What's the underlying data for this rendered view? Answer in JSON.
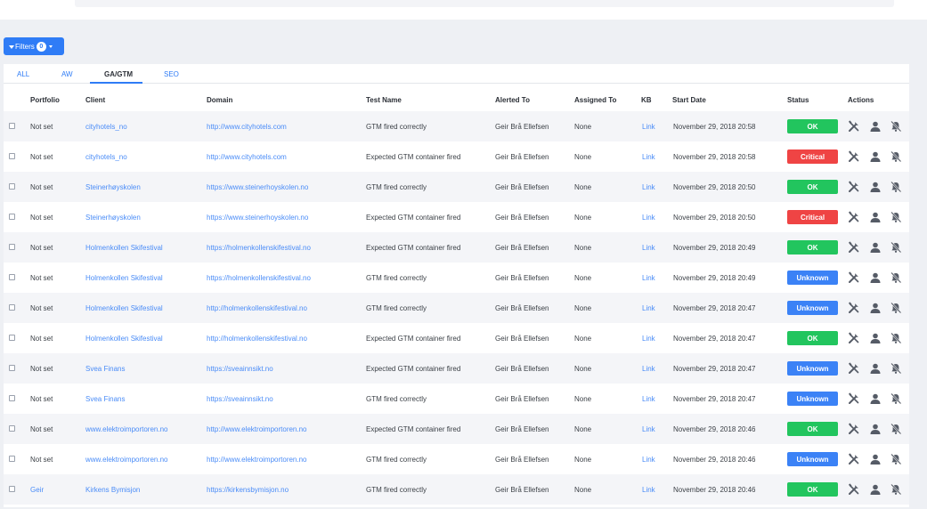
{
  "filters": {
    "label": "Filters",
    "count": "0"
  },
  "tabs": [
    "ALL",
    "AW",
    "GA/GTM",
    "SEO"
  ],
  "active_tab": "GA/GTM",
  "columns": [
    "Portfolio",
    "Client",
    "Domain",
    "Test Name",
    "Alerted To",
    "Assigned To",
    "KB",
    "Start Date",
    "Status",
    "Actions"
  ],
  "status_colors": {
    "OK": "#22c55e",
    "Critical": "#ef4444",
    "Unknown": "#3b82f6"
  },
  "icons": [
    "tools-icon",
    "user-icon",
    "bell-off-icon"
  ],
  "rows": [
    {
      "portfolio": "Not set",
      "client": "cityhotels_no",
      "domain": "http://www.cityhotels.com",
      "test": "GTM fired correctly",
      "alerted": "Geir Brå Ellefsen",
      "assigned": "None",
      "kb": "Link",
      "date": "November 29, 2018 20:58",
      "status": "OK"
    },
    {
      "portfolio": "Not set",
      "client": "cityhotels_no",
      "domain": "http://www.cityhotels.com",
      "test": "Expected GTM container fired",
      "alerted": "Geir Brå Ellefsen",
      "assigned": "None",
      "kb": "Link",
      "date": "November 29, 2018 20:58",
      "status": "Critical"
    },
    {
      "portfolio": "Not set",
      "client": "Steinerhøyskolen",
      "domain": "https://www.steinerhoyskolen.no",
      "test": "GTM fired correctly",
      "alerted": "Geir Brå Ellefsen",
      "assigned": "None",
      "kb": "Link",
      "date": "November 29, 2018 20:50",
      "status": "OK"
    },
    {
      "portfolio": "Not set",
      "client": "Steinerhøyskolen",
      "domain": "https://www.steinerhoyskolen.no",
      "test": "Expected GTM container fired",
      "alerted": "Geir Brå Ellefsen",
      "assigned": "None",
      "kb": "Link",
      "date": "November 29, 2018 20:50",
      "status": "Critical"
    },
    {
      "portfolio": "Not set",
      "client": "Holmenkollen Skifestival",
      "domain": "https://holmenkollenskifestival.no",
      "test": "Expected GTM container fired",
      "alerted": "Geir Brå Ellefsen",
      "assigned": "None",
      "kb": "Link",
      "date": "November 29, 2018 20:49",
      "status": "OK"
    },
    {
      "portfolio": "Not set",
      "client": "Holmenkollen Skifestival",
      "domain": "https://holmenkollenskifestival.no",
      "test": "GTM fired correctly",
      "alerted": "Geir Brå Ellefsen",
      "assigned": "None",
      "kb": "Link",
      "date": "November 29, 2018 20:49",
      "status": "Unknown"
    },
    {
      "portfolio": "Not set",
      "client": "Holmenkollen Skifestival",
      "domain": "http://holmenkollenskifestival.no",
      "test": "GTM fired correctly",
      "alerted": "Geir Brå Ellefsen",
      "assigned": "None",
      "kb": "Link",
      "date": "November 29, 2018 20:47",
      "status": "Unknown"
    },
    {
      "portfolio": "Not set",
      "client": "Holmenkollen Skifestival",
      "domain": "http://holmenkollenskifestival.no",
      "test": "Expected GTM container fired",
      "alerted": "Geir Brå Ellefsen",
      "assigned": "None",
      "kb": "Link",
      "date": "November 29, 2018 20:47",
      "status": "OK"
    },
    {
      "portfolio": "Not set",
      "client": "Svea Finans",
      "domain": "https://sveainnsikt.no",
      "test": "Expected GTM container fired",
      "alerted": "Geir Brå Ellefsen",
      "assigned": "None",
      "kb": "Link",
      "date": "November 29, 2018 20:47",
      "status": "Unknown"
    },
    {
      "portfolio": "Not set",
      "client": "Svea Finans",
      "domain": "https://sveainnsikt.no",
      "test": "GTM fired correctly",
      "alerted": "Geir Brå Ellefsen",
      "assigned": "None",
      "kb": "Link",
      "date": "November 29, 2018 20:47",
      "status": "Unknown"
    },
    {
      "portfolio": "Not set",
      "client": "www.elektroimportoren.no",
      "domain": "http://www.elektroimportoren.no",
      "test": "Expected GTM container fired",
      "alerted": "Geir Brå Ellefsen",
      "assigned": "None",
      "kb": "Link",
      "date": "November 29, 2018 20:46",
      "status": "OK"
    },
    {
      "portfolio": "Not set",
      "client": "www.elektroimportoren.no",
      "domain": "http://www.elektroimportoren.no",
      "test": "GTM fired correctly",
      "alerted": "Geir Brå Ellefsen",
      "assigned": "None",
      "kb": "Link",
      "date": "November 29, 2018 20:46",
      "status": "Unknown"
    },
    {
      "portfolio": "Geir",
      "client": "Kirkens Bymisjon",
      "domain": "https://kirkensbymisjon.no",
      "test": "GTM fired correctly",
      "alerted": "Geir Brå Ellefsen",
      "assigned": "None",
      "kb": "Link",
      "date": "November 29, 2018 20:46",
      "status": "OK"
    }
  ]
}
